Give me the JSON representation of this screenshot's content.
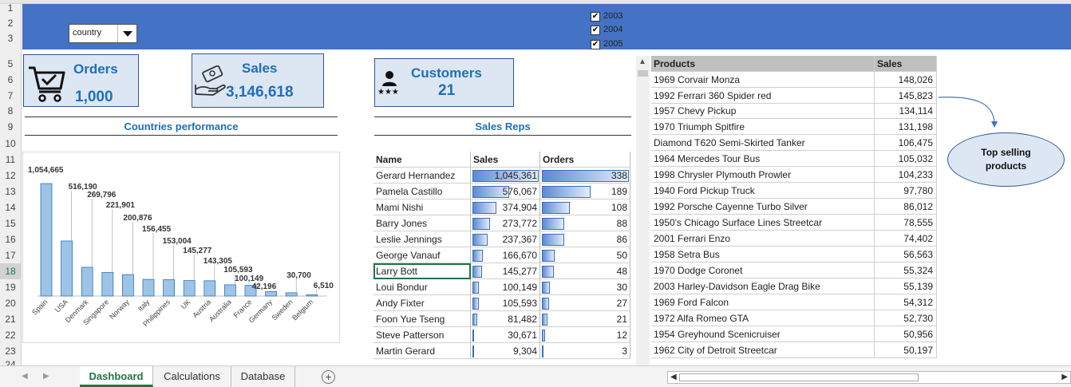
{
  "row_numbers": [
    "1",
    "2",
    "3",
    "5",
    "6",
    "7",
    "8",
    "9",
    "10",
    "11",
    "12",
    "13",
    "14",
    "15",
    "16",
    "17",
    "18",
    "19",
    "20",
    "21",
    "22",
    "23",
    "24"
  ],
  "filter": {
    "dropdown_value": "country",
    "years": [
      "2003",
      "2004",
      "2005"
    ],
    "checkmark": "✔"
  },
  "kpis": {
    "orders": {
      "label": "Orders",
      "value": "1,000"
    },
    "sales": {
      "label": "Sales",
      "value": "3,146,618"
    },
    "customers": {
      "label": "Customers",
      "value": "21"
    }
  },
  "sections": {
    "countries_title": "Countries performance",
    "reps_title": "Sales Reps"
  },
  "chart_data": {
    "type": "bar",
    "categories": [
      "Spain",
      "USA",
      "Denmark",
      "Singapore",
      "Norway",
      "Italy",
      "Philippines",
      "UK",
      "Austria",
      "Australia",
      "France",
      "Germany",
      "Sweden",
      "Belgium"
    ],
    "values": [
      1054665,
      516190,
      269796,
      221901,
      200876,
      156455,
      153004,
      145277,
      143305,
      105593,
      100149,
      42196,
      30700,
      6510
    ],
    "labels": [
      "1,054,665",
      "516,190",
      "269,796",
      "221,901",
      "200,876",
      "156,455",
      "153,004",
      "145,277",
      "143,305",
      "105,593",
      "100,149",
      "42,196",
      "30,700",
      "6,510"
    ],
    "title": "Countries performance",
    "ylim": [
      0,
      1100000
    ],
    "colors": {
      "bar": "#9dc3e6",
      "bar_border": "#2e75b6"
    }
  },
  "reps": {
    "headers": [
      "Name",
      "Sales",
      "Orders"
    ],
    "rows": [
      {
        "name": "Gerard Hernandez",
        "sales": "1,045,361",
        "orders": "338",
        "sales_v": 1045361,
        "orders_v": 338
      },
      {
        "name": "Pamela Castillo",
        "sales": "576,067",
        "orders": "189",
        "sales_v": 576067,
        "orders_v": 189
      },
      {
        "name": "Mami Nishi",
        "sales": "374,904",
        "orders": "108",
        "sales_v": 374904,
        "orders_v": 108
      },
      {
        "name": "Barry Jones",
        "sales": "273,772",
        "orders": "88",
        "sales_v": 273772,
        "orders_v": 88
      },
      {
        "name": "Leslie Jennings",
        "sales": "237,367",
        "orders": "86",
        "sales_v": 237367,
        "orders_v": 86
      },
      {
        "name": "George Vanauf",
        "sales": "166,670",
        "orders": "50",
        "sales_v": 166670,
        "orders_v": 50
      },
      {
        "name": "Larry Bott",
        "sales": "145,277",
        "orders": "48",
        "sales_v": 145277,
        "orders_v": 48
      },
      {
        "name": "Loui Bondur",
        "sales": "100,149",
        "orders": "30",
        "sales_v": 100149,
        "orders_v": 30
      },
      {
        "name": "Andy Fixter",
        "sales": "105,593",
        "orders": "27",
        "sales_v": 105593,
        "orders_v": 27
      },
      {
        "name": "Foon Yue Tseng",
        "sales": "81,482",
        "orders": "21",
        "sales_v": 81482,
        "orders_v": 21
      },
      {
        "name": "Steve Patterson",
        "sales": "30,671",
        "orders": "12",
        "sales_v": 30671,
        "orders_v": 12
      },
      {
        "name": "Martin Gerard",
        "sales": "9,304",
        "orders": "3",
        "sales_v": 9304,
        "orders_v": 3
      }
    ]
  },
  "products": {
    "headers": [
      "Products",
      "Sales"
    ],
    "rows": [
      {
        "name": "1969 Corvair Monza",
        "sales": "148,026"
      },
      {
        "name": "1992 Ferrari 360 Spider red",
        "sales": "145,823"
      },
      {
        "name": "1957 Chevy Pickup",
        "sales": "134,114"
      },
      {
        "name": "1970 Triumph Spitfire",
        "sales": "131,198"
      },
      {
        "name": "Diamond T620 Semi-Skirted Tanker",
        "sales": "106,475"
      },
      {
        "name": "1964 Mercedes Tour Bus",
        "sales": "105,032"
      },
      {
        "name": "1998 Chrysler Plymouth Prowler",
        "sales": "104,233"
      },
      {
        "name": "1940 Ford Pickup Truck",
        "sales": "97,780"
      },
      {
        "name": "1992 Porsche Cayenne Turbo Silver",
        "sales": "86,012"
      },
      {
        "name": "1950's Chicago Surface Lines Streetcar",
        "sales": "78,555"
      },
      {
        "name": "2001 Ferrari Enzo",
        "sales": "74,402"
      },
      {
        "name": "1958 Setra Bus",
        "sales": "56,563"
      },
      {
        "name": "1970 Dodge Coronet",
        "sales": "55,324"
      },
      {
        "name": "2003 Harley-Davidson Eagle Drag Bike",
        "sales": "55,139"
      },
      {
        "name": "1969 Ford Falcon",
        "sales": "54,312"
      },
      {
        "name": "1972 Alfa Romeo GTA",
        "sales": "52,730"
      },
      {
        "name": "1954 Greyhound Scenicruiser",
        "sales": "50,956"
      },
      {
        "name": "1962 City of Detroit Streetcar",
        "sales": "50,197"
      }
    ]
  },
  "callout": {
    "text_line1": "Top selling",
    "text_line2": "products"
  },
  "sheet_tabs": {
    "active": "Dashboard",
    "tabs": [
      "Dashboard",
      "Calculations",
      "Database"
    ],
    "add_symbol": "+"
  },
  "colors": {
    "band": "#4472c4",
    "accent": "#1f6fb8",
    "excel_green": "#217346"
  }
}
